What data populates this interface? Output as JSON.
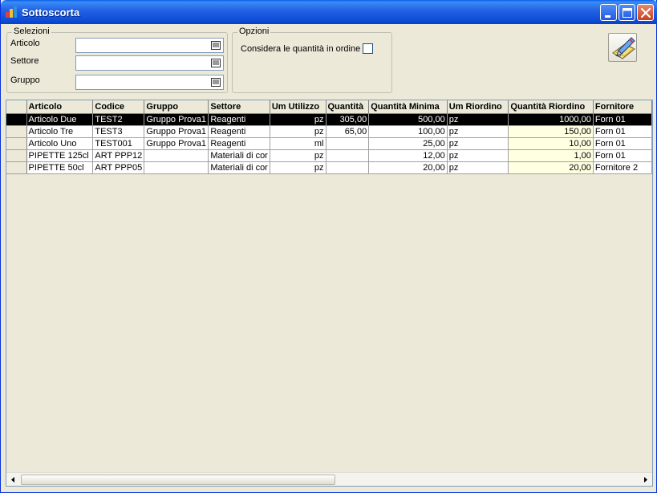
{
  "window": {
    "title": "Sottoscorta"
  },
  "selezioni": {
    "legend": "Selezioni",
    "fields": [
      {
        "label": "Articolo",
        "value": ""
      },
      {
        "label": "Settore",
        "value": ""
      },
      {
        "label": "Gruppo",
        "value": ""
      }
    ]
  },
  "opzioni": {
    "legend": "Opzioni",
    "checkbox_label": "Considera le quantità in ordine",
    "checked": false
  },
  "grid": {
    "columns": [
      "Articolo",
      "Codice",
      "Gruppo",
      "Settore",
      "Um Utilizzo",
      "Quantità",
      "Quantità Minima",
      "Um Riordino",
      "Quantità Riordino",
      "Fornitore"
    ],
    "rows": [
      [
        "Articolo Due",
        "TEST2",
        "Gruppo Prova1",
        "Reagenti",
        "pz",
        "305,00",
        "500,00",
        "pz",
        "1000,00",
        "Forn 01"
      ],
      [
        "Articolo Tre",
        "TEST3",
        "Gruppo Prova1",
        "Reagenti",
        "pz",
        "65,00",
        "100,00",
        "pz",
        "150,00",
        "Forn 01"
      ],
      [
        "Articolo Uno",
        "TEST001",
        "Gruppo Prova1",
        "Reagenti",
        "ml",
        "",
        "25,00",
        "pz",
        "10,00",
        "Forn 01"
      ],
      [
        "PIPETTE 125cl",
        "ART PPP12",
        "",
        "Materiali di cor",
        "pz",
        "",
        "12,00",
        "pz",
        "1,00",
        "Forn 01"
      ],
      [
        "PIPETTE 50cl",
        "ART PPP05",
        "",
        "Materiali di cor",
        "pz",
        "",
        "20,00",
        "pz",
        "20,00",
        "Fornitore 2"
      ]
    ],
    "selected_row": 0
  }
}
